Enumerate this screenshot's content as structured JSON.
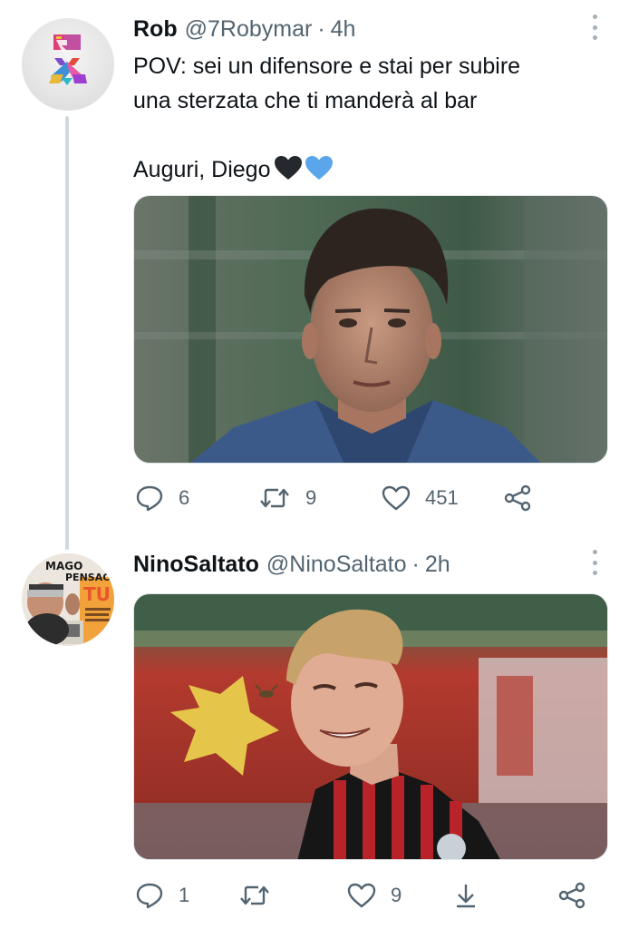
{
  "tweets": [
    {
      "name": "Rob",
      "handle": "@7Robymar",
      "separator": "·",
      "time": "4h",
      "text_line1": "POV: sei un difensore e stai per subire",
      "text_line2": "una sterzata che ti manderà al bar",
      "text_line3": "Auguri, Diego",
      "emojis": [
        "black-heart",
        "blue-heart"
      ],
      "replies": "6",
      "retweets": "9",
      "likes": "451"
    },
    {
      "name": "NinoSaltato",
      "handle": "@NinoSaltato",
      "separator": "·",
      "time": "2h",
      "avatar_text_line1": "MAGO",
      "avatar_text_line2": "PENSAC",
      "avatar_text_line3": "TU",
      "replies": "1",
      "retweets": "",
      "likes": "9"
    }
  ],
  "colors": {
    "text": "#0f1419",
    "muted": "#536471",
    "thread_line": "#cfd9de",
    "blue_heart": "#5ba6ea",
    "black_heart": "#25292e"
  }
}
